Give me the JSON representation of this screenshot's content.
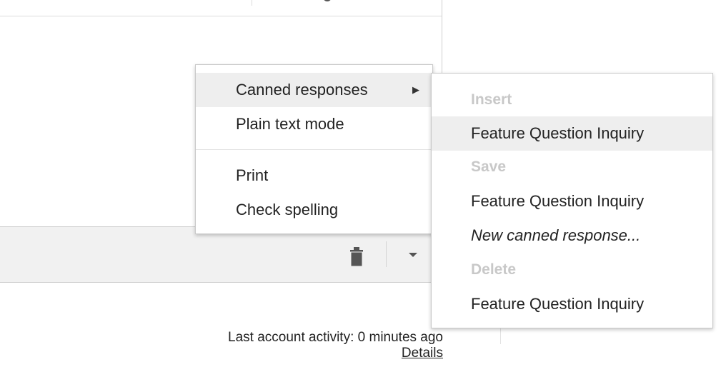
{
  "main_menu": {
    "items": [
      {
        "label": "Canned responses",
        "highlighted": true,
        "submenu_arrow": "▶"
      },
      {
        "label": "Plain text mode",
        "highlighted": false
      },
      {
        "label": "Print",
        "highlighted": false
      },
      {
        "label": "Check spelling",
        "highlighted": false
      }
    ]
  },
  "canned_submenu": {
    "insert_header": "Insert",
    "insert_item": "Feature Question Inquiry",
    "save_header": "Save",
    "save_item": "Feature Question Inquiry",
    "new_response": "New canned response...",
    "delete_header": "Delete",
    "delete_item": "Feature Question Inquiry"
  },
  "toolbar": {
    "trash_icon": "trash-icon",
    "more_icon": "caret-down-icon"
  },
  "footer": {
    "activity_text": "Last account activity: 0 minutes ago",
    "details_link": "Details"
  },
  "colors": {
    "highlight_bg": "#eeeeee",
    "header_text": "#c8c8c8",
    "toolbar_bg": "#f1f1f1"
  }
}
